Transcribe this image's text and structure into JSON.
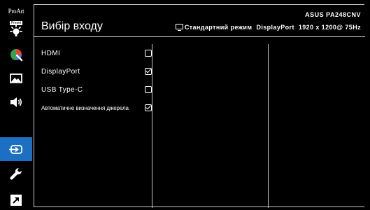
{
  "logo": {
    "line1": "ProArt",
    "line2": "Preset"
  },
  "header": {
    "title": "Вибір входу",
    "model": "ASUS PA248CNV",
    "mode": "Стандартний режим",
    "input": "DisplayPort",
    "resolution": "1920 x 1200@  75Hz"
  },
  "sidebar": {
    "items": [
      {
        "icon": "brightness-icon",
        "active": false
      },
      {
        "icon": "color-icon",
        "active": false
      },
      {
        "icon": "image-icon",
        "active": false
      },
      {
        "icon": "sound-icon",
        "active": false
      },
      {
        "icon": "input-select-icon",
        "active": true
      },
      {
        "icon": "system-setup-icon",
        "active": false
      },
      {
        "icon": "shortcut-icon",
        "active": false
      }
    ]
  },
  "options": [
    {
      "label": "HDMI",
      "checked": false
    },
    {
      "label": "DisplayPort",
      "checked": true
    },
    {
      "label": "USB Type-C",
      "checked": false
    },
    {
      "label": "Автоматичне визначення джерела",
      "checked": true
    }
  ],
  "colors": {
    "accent": "#1d6fc2",
    "background": "#000000",
    "border": "#c8c8c8",
    "text": "#ffffff"
  }
}
